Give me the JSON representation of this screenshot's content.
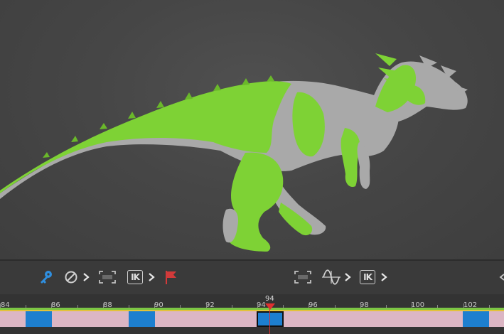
{
  "viewport": {
    "subject": "dinosaur-model",
    "colors": {
      "mesh_gray": "#a9a9a9",
      "paint_green": "#7ed235"
    }
  },
  "toolbar": {
    "ik_left": "IK",
    "ik_right": "IK",
    "colors": {
      "key_icon": "#2f8fe0",
      "flag_icon": "#d23a3a",
      "icon": "#d0d0d0"
    }
  },
  "timeline": {
    "playhead_frame": "94",
    "ruler": [
      "84",
      "86",
      "88",
      "90",
      "92",
      "94",
      "96",
      "98",
      "100",
      "102"
    ],
    "keyframes": [
      85,
      89,
      94,
      103
    ],
    "selected_key": 94,
    "colors": {
      "range": "#dcb6c4",
      "key": "#1d7fcf",
      "playhead": "#e03030",
      "green": "#7cc644",
      "yellow": "#e2c23a"
    }
  }
}
